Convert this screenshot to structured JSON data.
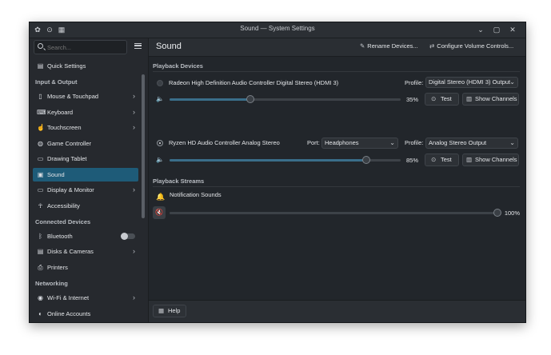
{
  "window": {
    "title": "Sound — System Settings",
    "titlebar_icons": [
      "app-icon",
      "pin-icon",
      "grid-icon"
    ],
    "controls": [
      "minimize",
      "maximize",
      "close"
    ]
  },
  "sidebar": {
    "search_placeholder": "Search...",
    "quick_settings": "Quick Settings",
    "sections": {
      "input_output": "Input & Output",
      "connected_devices": "Connected Devices",
      "networking": "Networking"
    },
    "items": [
      {
        "label": "Mouse & Touchpad",
        "icon": "mouse-icon"
      },
      {
        "label": "Keyboard",
        "icon": "keyboard-icon"
      },
      {
        "label": "Touchscreen",
        "icon": "touchscreen-icon"
      },
      {
        "label": "Game Controller",
        "icon": "gamepad-icon"
      },
      {
        "label": "Drawing Tablet",
        "icon": "tablet-icon"
      },
      {
        "label": "Sound",
        "icon": "speaker-icon",
        "active": true
      },
      {
        "label": "Display & Monitor",
        "icon": "monitor-icon"
      },
      {
        "label": "Accessibility",
        "icon": "accessibility-icon"
      },
      {
        "label": "Bluetooth",
        "icon": "bluetooth-icon",
        "toggle": false
      },
      {
        "label": "Disks & Cameras",
        "icon": "disk-icon"
      },
      {
        "label": "Printers",
        "icon": "printer-icon"
      },
      {
        "label": "Wi-Fi & Internet",
        "icon": "wifi-icon"
      },
      {
        "label": "Online Accounts",
        "icon": "accounts-icon"
      }
    ]
  },
  "header": {
    "title": "Sound",
    "rename_devices": "Rename Devices...",
    "configure_volume": "Configure Volume Controls..."
  },
  "playback_devices": {
    "heading": "Playback Devices",
    "devices": [
      {
        "name": "Radeon High Definition Audio Controller Digital Stereo (HDMI 3)",
        "selected": false,
        "profile_label": "Profile:",
        "profile": "Digital Stereo (HDMI 3) Output",
        "volume": 35,
        "volume_text": "35%",
        "test": "Test",
        "show_channels": "Show Channels"
      },
      {
        "name": "Ryzen HD Audio Controller Analog Stereo",
        "selected": true,
        "port_label": "Port:",
        "port": "Headphones",
        "profile_label": "Profile:",
        "profile": "Analog Stereo Output",
        "volume": 85,
        "volume_text": "85%",
        "test": "Test",
        "show_channels": "Show Channels"
      }
    ]
  },
  "playback_streams": {
    "heading": "Playback Streams",
    "streams": [
      {
        "name": "Notification Sounds",
        "volume": 100,
        "volume_text": "100%",
        "muted": true
      }
    ]
  },
  "footer": {
    "help": "Help"
  },
  "colors": {
    "accent": "#1e5b78",
    "background": "#22262b",
    "slider_fill": "#3a6e8a"
  }
}
